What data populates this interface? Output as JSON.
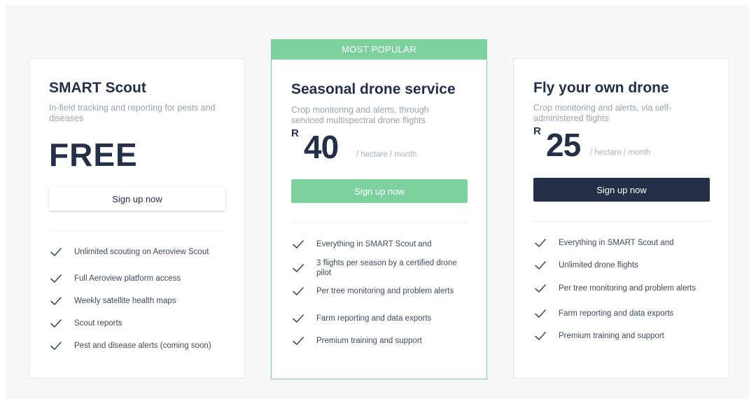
{
  "colors": {
    "accent_green": "#7dd19f",
    "navy": "#243047",
    "muted_text": "#9aa3ad"
  },
  "featured_badge": "MOST POPULAR",
  "plans": [
    {
      "title": "SMART Scout",
      "description": "In-field tracking and reporting for pests and diseases",
      "price": "FREE",
      "button": "Sign up now",
      "features": [
        "Unlimited scouting on Aeroview Scout",
        "Full Aeroview platform access",
        "Weekly satellite health maps",
        "Scout reports",
        "Pest and disease alerts (coming soon)"
      ]
    },
    {
      "title": "Seasonal drone service",
      "description": "Crop monitoring and alerts, through serviced multispectral drone flights",
      "currency": "R",
      "amount": "40",
      "unit": "/ hectare / month",
      "button": "Sign up now",
      "features": [
        "Everything in SMART Scout and",
        "3 flights per season by a certified drone pilot",
        "Per tree monitoring and problem alerts",
        "Farm reporting and data exports",
        "Premium training and support"
      ]
    },
    {
      "title": "Fly your own drone",
      "description": "Crop monitoring and alerts, via self-administered flights",
      "currency": "R",
      "amount": "25",
      "unit": "/ hectare / month",
      "button": "Sign up now",
      "features": [
        "Everything in SMART Scout and",
        "Unlimited drone flights",
        "Per tree monitoring and problem alerts",
        "Farm reporting and data exports",
        "Premium training and support"
      ]
    }
  ],
  "icons": {
    "feature_check": "check-icon"
  }
}
